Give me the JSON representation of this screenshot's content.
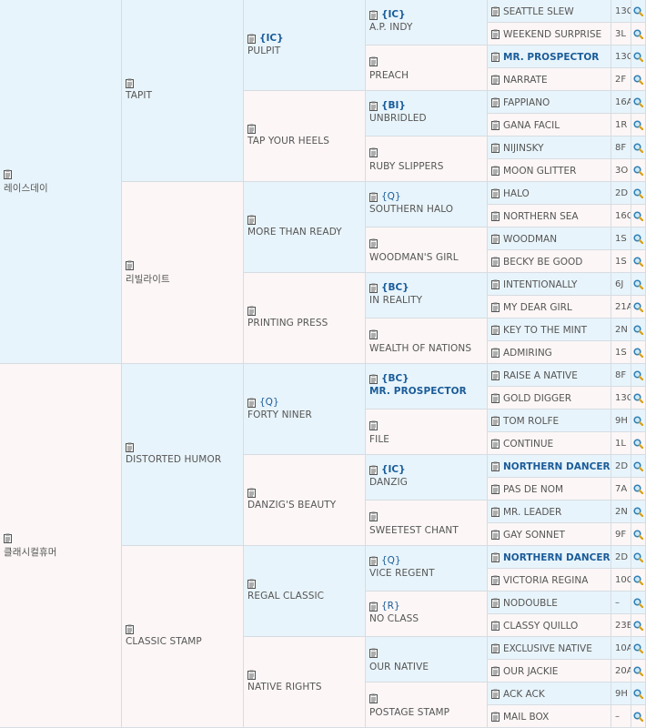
{
  "pedigree": {
    "gen1": [
      {
        "name": "레이스데이"
      },
      {
        "name": "클래시컬휴머"
      }
    ],
    "gen2": [
      {
        "name": "TAPIT"
      },
      {
        "name": "리빌라이트"
      },
      {
        "name": "DISTORTED HUMOR"
      },
      {
        "name": "CLASSIC STAMP"
      }
    ],
    "gen3": [
      {
        "name": "PULPIT",
        "tag": "{IC}"
      },
      {
        "name": "TAP YOUR HEELS",
        "tag": ""
      },
      {
        "name": "MORE THAN READY",
        "tag": ""
      },
      {
        "name": "PRINTING PRESS",
        "tag": ""
      },
      {
        "name": "FORTY NINER",
        "tag": "{Q}"
      },
      {
        "name": "DANZIG'S BEAUTY",
        "tag": ""
      },
      {
        "name": "REGAL CLASSIC",
        "tag": ""
      },
      {
        "name": "NATIVE RIGHTS",
        "tag": ""
      }
    ],
    "gen4": [
      {
        "name": "A.P. INDY",
        "tag": "{IC}",
        "hl": false
      },
      {
        "name": "PREACH",
        "tag": "",
        "hl": false
      },
      {
        "name": "UNBRIDLED",
        "tag": "{BI}",
        "hl": false
      },
      {
        "name": "RUBY SLIPPERS",
        "tag": "",
        "hl": false
      },
      {
        "name": "SOUTHERN HALO",
        "tag": "{Q}",
        "hl": false
      },
      {
        "name": "WOODMAN'S GIRL",
        "tag": "",
        "hl": false
      },
      {
        "name": "IN REALITY",
        "tag": "{BC}",
        "hl": false
      },
      {
        "name": "WEALTH OF NATIONS",
        "tag": "",
        "hl": false
      },
      {
        "name": "MR. PROSPECTOR",
        "tag": "{BC}",
        "hl": true
      },
      {
        "name": "FILE",
        "tag": "",
        "hl": false
      },
      {
        "name": "DANZIG",
        "tag": "{IC}",
        "hl": false
      },
      {
        "name": "SWEETEST CHANT",
        "tag": "",
        "hl": false
      },
      {
        "name": "VICE REGENT",
        "tag": "{Q}",
        "hl": false
      },
      {
        "name": "NO CLASS",
        "tag": "{R}",
        "hl": false
      },
      {
        "name": "OUR NATIVE",
        "tag": "",
        "hl": false
      },
      {
        "name": "POSTAGE STAMP",
        "tag": "",
        "hl": false
      }
    ],
    "gen5": [
      {
        "name": "SEATTLE SLEW",
        "code": "13C",
        "hl": false
      },
      {
        "name": "WEEKEND SURPRISE",
        "code": "3L",
        "hl": false
      },
      {
        "name": "MR. PROSPECTOR",
        "code": "13C",
        "hl": true
      },
      {
        "name": "NARRATE",
        "code": "2F",
        "hl": false
      },
      {
        "name": "FAPPIANO",
        "code": "16A",
        "hl": false
      },
      {
        "name": "GANA FACIL",
        "code": "1R",
        "hl": false
      },
      {
        "name": "NIJINSKY",
        "code": "8F",
        "hl": false
      },
      {
        "name": "MOON GLITTER",
        "code": "3O",
        "hl": false
      },
      {
        "name": "HALO",
        "code": "2D",
        "hl": false
      },
      {
        "name": "NORTHERN SEA",
        "code": "16C",
        "hl": false
      },
      {
        "name": "WOODMAN",
        "code": "1S",
        "hl": false
      },
      {
        "name": "BECKY BE GOOD",
        "code": "1S",
        "hl": false
      },
      {
        "name": "INTENTIONALLY",
        "code": "6J",
        "hl": false
      },
      {
        "name": "MY DEAR GIRL",
        "code": "21A",
        "hl": false
      },
      {
        "name": "KEY TO THE MINT",
        "code": "2N",
        "hl": false
      },
      {
        "name": "ADMIRING",
        "code": "1S",
        "hl": false
      },
      {
        "name": "RAISE A NATIVE",
        "code": "8F",
        "hl": false
      },
      {
        "name": "GOLD DIGGER",
        "code": "13C",
        "hl": false
      },
      {
        "name": "TOM ROLFE",
        "code": "9H",
        "hl": false
      },
      {
        "name": "CONTINUE",
        "code": "1L",
        "hl": false
      },
      {
        "name": "NORTHERN DANCER",
        "code": "2D",
        "hl": true
      },
      {
        "name": "PAS DE NOM",
        "code": "7A",
        "hl": false
      },
      {
        "name": "MR. LEADER",
        "code": "2N",
        "hl": false
      },
      {
        "name": "GAY SONNET",
        "code": "9F",
        "hl": false
      },
      {
        "name": "NORTHERN DANCER",
        "code": "2D",
        "hl": true
      },
      {
        "name": "VICTORIA REGINA",
        "code": "10C",
        "hl": false
      },
      {
        "name": "NODOUBLE",
        "code": "–",
        "hl": false
      },
      {
        "name": "CLASSY QUILLO",
        "code": "23E",
        "hl": false
      },
      {
        "name": "EXCLUSIVE NATIVE",
        "code": "10A",
        "hl": false
      },
      {
        "name": "OUR JACKIE",
        "code": "20A",
        "hl": false
      },
      {
        "name": "ACK ACK",
        "code": "9H",
        "hl": false
      },
      {
        "name": "MAIL BOX",
        "code": "–",
        "hl": false
      }
    ]
  },
  "icons": {
    "clipboard": "clipboard-icon",
    "search": "magnifier-icon"
  },
  "colors": {
    "blue_bg": "#e8f4fb",
    "pink_bg": "#fcf6f6",
    "tag": "#1a5c99",
    "border": "#d6dde2"
  }
}
